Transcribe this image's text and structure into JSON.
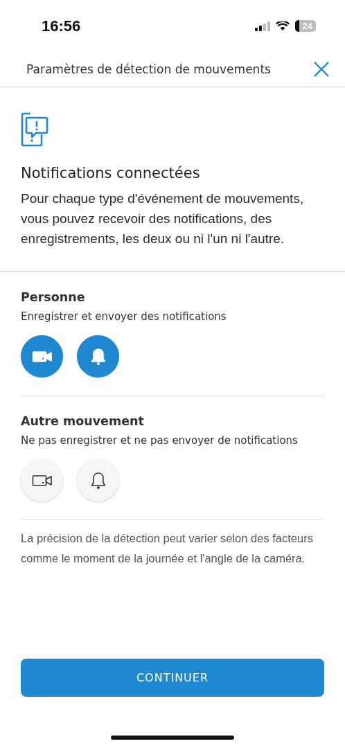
{
  "status_bar": {
    "time": "16:56",
    "battery": "24"
  },
  "header": {
    "title": "Paramètres de détection de mouvements"
  },
  "intro": {
    "heading": "Notifications connectées",
    "text": "Pour chaque type d'événement de mouvements, vous pouvez recevoir des notifications, des enregistrements, les deux ou ni l'un ni l'autre."
  },
  "sections": [
    {
      "title": "Personne",
      "status": "Enregistrer et envoyer des notifications",
      "toggles": [
        {
          "kind": "record",
          "on": true
        },
        {
          "kind": "notify",
          "on": true
        }
      ]
    },
    {
      "title": "Autre mouvement",
      "status": "Ne pas enregistrer et ne pas envoyer de notifications",
      "toggles": [
        {
          "kind": "record",
          "on": false
        },
        {
          "kind": "notify",
          "on": false
        }
      ]
    }
  ],
  "footnote": "La précision de la détection peut varier selon des facteurs comme le moment de la journée et l'angle de la caméra.",
  "button": "CONTINUER"
}
